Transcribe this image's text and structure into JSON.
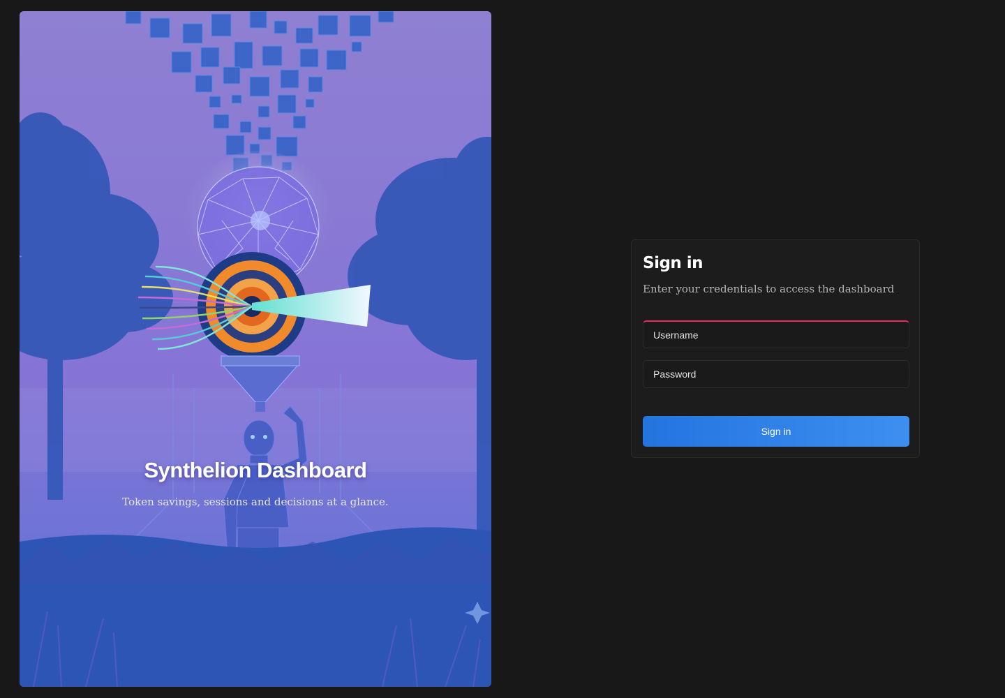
{
  "hero": {
    "title": "Synthelion Dashboard",
    "subtitle": "Token savings, sessions and decisions at a glance.",
    "colors": {
      "sky_top": "#8f80d2",
      "sky_mid": "#8777d4",
      "ground": "#2553b0",
      "tree": "#3a5cbc",
      "accent_orange": "#f08a2a",
      "accent_teal": "#7fe6d8"
    },
    "illustration": "robot-with-lens-icon"
  },
  "signin": {
    "title": "Sign in",
    "subtitle": "Enter your credentials to access the dashboard",
    "username_placeholder": "Username",
    "password_placeholder": "Password",
    "submit_label": "Sign in",
    "colors": {
      "button": "#2c82ea",
      "focus_accent": "#e8305a",
      "card": "#1c1c1c",
      "page": "#181818"
    }
  }
}
